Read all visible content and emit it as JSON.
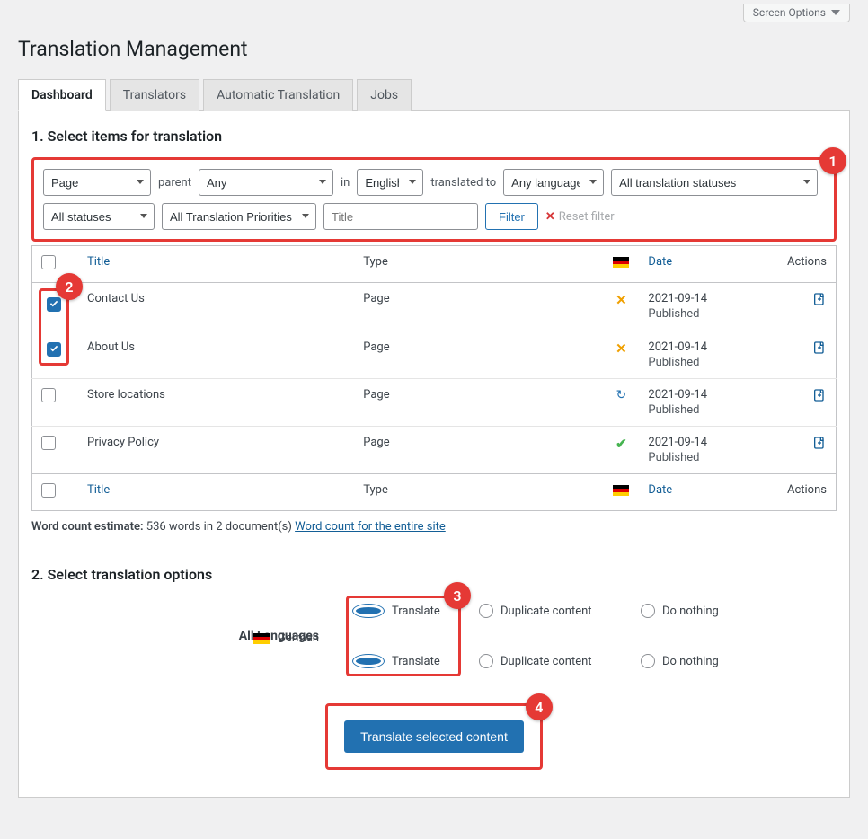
{
  "screen_options": "Screen Options",
  "page_title": "Translation Management",
  "tabs": [
    "Dashboard",
    "Translators",
    "Automatic Translation",
    "Jobs"
  ],
  "section1_title": "1. Select items for translation",
  "filters": {
    "post_type": "Page",
    "parent_label": "parent",
    "parent": "Any",
    "in_label": "in",
    "language": "English",
    "translated_to_label": "translated to",
    "target_lang": "Any language",
    "translation_status": "All translation statuses",
    "status": "All statuses",
    "priority": "All Translation Priorities",
    "title_placeholder": "Title",
    "filter_btn": "Filter",
    "reset": "Reset filter"
  },
  "table": {
    "headers": {
      "title": "Title",
      "type": "Type",
      "date": "Date",
      "actions": "Actions"
    },
    "rows": [
      {
        "checked": true,
        "title": "Contact Us",
        "type": "Page",
        "status_icon": "x",
        "date": "2021-09-14",
        "pub": "Published"
      },
      {
        "checked": true,
        "title": "About Us",
        "type": "Page",
        "status_icon": "x",
        "date": "2021-09-14",
        "pub": "Published"
      },
      {
        "checked": false,
        "title": "Store locations",
        "type": "Page",
        "status_icon": "refresh",
        "date": "2021-09-14",
        "pub": "Published"
      },
      {
        "checked": false,
        "title": "Privacy Policy",
        "type": "Page",
        "status_icon": "check",
        "date": "2021-09-14",
        "pub": "Published"
      }
    ]
  },
  "word_count": {
    "label": "Word count estimate:",
    "text": "536 words in 2 document(s)",
    "link": "Word count for the entire site"
  },
  "section2_title": "2. Select translation options",
  "options": {
    "all_languages": "All Languages",
    "german": "German",
    "translate": "Translate",
    "duplicate": "Duplicate content",
    "nothing": "Do nothing"
  },
  "primary_button": "Translate selected content",
  "badges": {
    "b1": "1",
    "b2": "2",
    "b3": "3",
    "b4": "4"
  }
}
